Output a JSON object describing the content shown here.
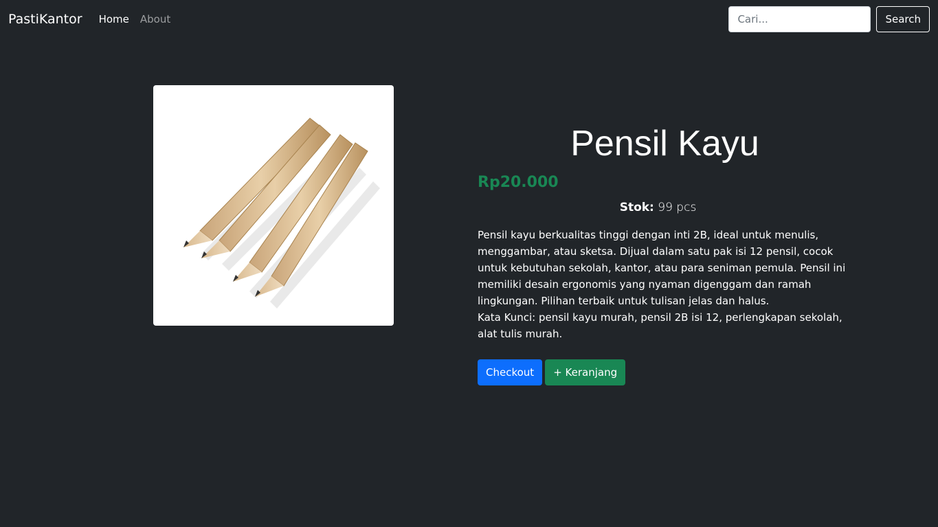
{
  "navbar": {
    "brand": "PastiKantor",
    "links": [
      {
        "label": "Home",
        "active": true
      },
      {
        "label": "About",
        "active": false
      }
    ],
    "search": {
      "placeholder": "Cari...",
      "value": "",
      "button_label": "Search"
    }
  },
  "product": {
    "image_icon": "pencils-image",
    "title": "Pensil Kayu",
    "price": "Rp20.000",
    "stock_label": "Stok:",
    "stock_value": "99 pcs",
    "description": "Pensil kayu berkualitas tinggi dengan inti 2B, ideal untuk menulis, menggambar, atau sketsa. Dijual dalam satu pak isi 12 pensil, cocok untuk kebutuhan sekolah, kantor, atau para seniman pemula. Pensil ini memiliki desain ergonomis yang nyaman digenggam dan ramah lingkungan. Pilihan terbaik untuk tulisan jelas dan halus.",
    "keywords": "Kata Kunci: pensil kayu murah, pensil 2B isi 12, perlengkapan sekolah, alat tulis murah.",
    "checkout_label": "Checkout",
    "cart_label": "+ Keranjang"
  },
  "colors": {
    "background": "#212529",
    "price": "#198754",
    "checkout": "#0d6efd",
    "cart": "#198754"
  }
}
